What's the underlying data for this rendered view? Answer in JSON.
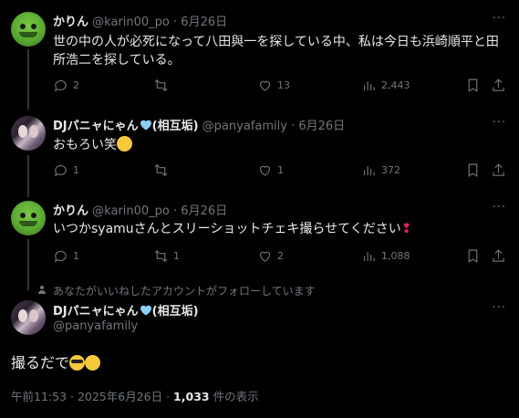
{
  "tweets": [
    {
      "name": "かりん",
      "handle": "@karin00_po",
      "sep": "·",
      "date": "6月26日",
      "text": "世の中の人が必死になって八田與一を探している中、私は今日も浜崎順平と田所浩二を探している。",
      "replies": "2",
      "retweets": "",
      "likes": "13",
      "views": "2,443"
    },
    {
      "name": "DJパニャにゃん",
      "name_suffix": "(相互垢)",
      "handle": "@panyafamily",
      "sep": "·",
      "date": "6月26日",
      "text": "おもろい笑",
      "replies": "1",
      "retweets": "",
      "likes": "1",
      "views": "372"
    },
    {
      "name": "かりん",
      "handle": "@karin00_po",
      "sep": "·",
      "date": "6月26日",
      "text": "いつかsyamuさんとスリーショットチェキ撮らせてください",
      "replies": "1",
      "retweets": "1",
      "likes": "2",
      "views": "1,088"
    }
  ],
  "reply_note": "あなたがいいねしたアカウントがフォローしています",
  "main_tweet": {
    "name": "DJパニャにゃん",
    "name_suffix": "(相互垢)",
    "handle": "@panyafamily",
    "text": "撮るだで",
    "time": "午前11:53 · 2025年6月26日 · ",
    "views_count": "1,033",
    "views_label": " 件の表示"
  },
  "more_label": "···",
  "colors": {
    "bg": "#000000",
    "text": "#e7e9ea",
    "muted": "#71767b",
    "heart_blue": "#8ecdf7"
  }
}
